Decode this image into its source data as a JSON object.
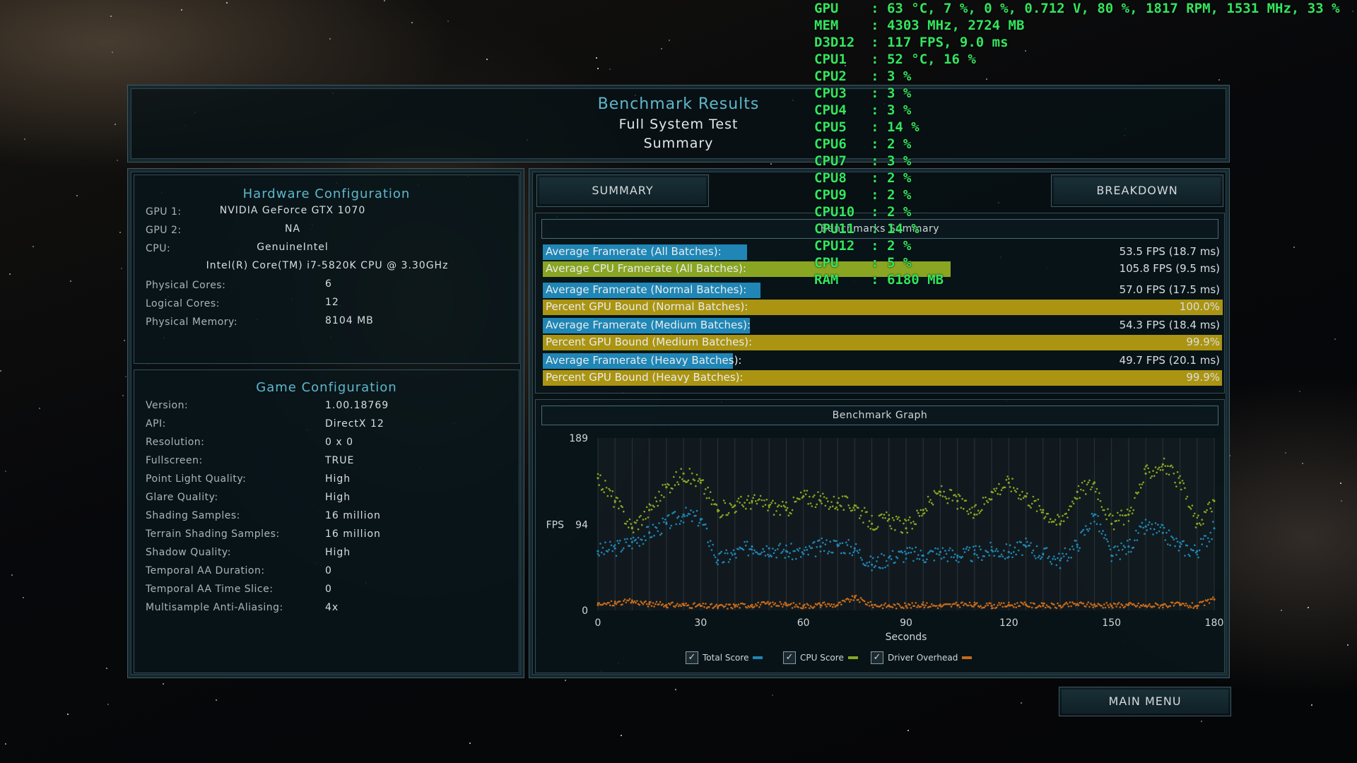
{
  "header": {
    "title": "Benchmark Results",
    "subtitle": "Full System Test",
    "subtitle2": "Summary"
  },
  "hardware": {
    "title": "Hardware Configuration",
    "rows": [
      {
        "label": "GPU 1:",
        "value": "NVIDIA GeForce GTX 1070"
      },
      {
        "label": "GPU 2:",
        "value": "NA"
      },
      {
        "label": "CPU:",
        "value": "GenuineIntel"
      },
      {
        "label": "",
        "value": "Intel(R) Core(TM) i7-5820K CPU @ 3.30GHz"
      },
      {
        "label": "Physical Cores:",
        "value": "6"
      },
      {
        "label": "Logical Cores:",
        "value": "12"
      },
      {
        "label": "Physical Memory:",
        "value": "8104 MB"
      }
    ]
  },
  "game": {
    "title": "Game Configuration",
    "rows": [
      {
        "label": "Version:",
        "value": "1.00.18769"
      },
      {
        "label": "API:",
        "value": "DirectX 12"
      },
      {
        "label": "Resolution:",
        "value": "0 x 0"
      },
      {
        "label": "Fullscreen:",
        "value": "TRUE"
      },
      {
        "label": "Point Light Quality:",
        "value": "High"
      },
      {
        "label": "Glare Quality:",
        "value": "High"
      },
      {
        "label": "Shading Samples:",
        "value": "16 million"
      },
      {
        "label": "Terrain Shading Samples:",
        "value": "16 million"
      },
      {
        "label": "Shadow Quality:",
        "value": "High"
      },
      {
        "label": "Temporal AA Duration:",
        "value": "0"
      },
      {
        "label": "Temporal AA Time Slice:",
        "value": "0"
      },
      {
        "label": "Multisample Anti-Aliasing:",
        "value": "4x"
      }
    ]
  },
  "tabs": {
    "summary": "SUMMARY",
    "breakdown": "BREAKDOWN"
  },
  "summary": {
    "title": "Benchmarks Summary",
    "rows": [
      {
        "label": "Average Framerate (All Batches):",
        "value": "53.5 FPS (18.7 ms)",
        "fill": 0.3,
        "color": "#1f86b5"
      },
      {
        "label": "Average CPU Framerate (All Batches):",
        "value": "105.8 FPS (9.5 ms)",
        "fill": 0.6,
        "color": "#8aa521"
      },
      {
        "label": "Average Framerate (Normal Batches):",
        "value": "57.0 FPS (17.5 ms)",
        "fill": 0.32,
        "color": "#1f86b5"
      },
      {
        "label": "Percent GPU Bound (Normal Batches):",
        "value": "100.0%",
        "fill": 1.0,
        "color": "#ab9411"
      },
      {
        "label": "Average Framerate (Medium Batches):",
        "value": "54.3 FPS (18.4 ms)",
        "fill": 0.305,
        "color": "#1f86b5"
      },
      {
        "label": "Percent GPU Bound (Medium Batches):",
        "value": "99.9%",
        "fill": 0.999,
        "color": "#ab9411"
      },
      {
        "label": "Average Framerate (Heavy Batches):",
        "value": "49.7 FPS (20.1 ms)",
        "fill": 0.28,
        "color": "#1f86b5"
      },
      {
        "label": "Percent GPU Bound (Heavy Batches):",
        "value": "99.9%",
        "fill": 0.999,
        "color": "#ab9411"
      }
    ]
  },
  "graph": {
    "title": "Benchmark Graph",
    "ylabel": "FPS",
    "xlabel": "Seconds",
    "legend": [
      {
        "label": "Total Score",
        "color": "#1f86b5"
      },
      {
        "label": "CPU Score",
        "color": "#8aa521"
      },
      {
        "label": "Driver Overhead",
        "color": "#c56a1a"
      }
    ]
  },
  "chart_data": {
    "type": "scatter",
    "title": "Benchmark Graph",
    "xlabel": "Seconds",
    "ylabel": "FPS",
    "xlim": [
      0,
      180
    ],
    "ylim": [
      0,
      189
    ],
    "xticks": [
      0,
      30,
      60,
      90,
      120,
      150,
      180
    ],
    "yticks": [
      0,
      94,
      189
    ],
    "x": [
      0,
      5,
      10,
      15,
      20,
      25,
      30,
      35,
      40,
      45,
      50,
      55,
      60,
      65,
      70,
      75,
      80,
      85,
      90,
      95,
      100,
      105,
      110,
      115,
      120,
      125,
      130,
      135,
      140,
      145,
      150,
      155,
      160,
      165,
      170,
      175,
      180
    ],
    "series": [
      {
        "name": "Total Score",
        "color": "#1f86b5",
        "values": [
          65,
          68,
          75,
          85,
          95,
          105,
          100,
          55,
          62,
          70,
          68,
          65,
          62,
          70,
          72,
          68,
          50,
          58,
          62,
          60,
          64,
          60,
          62,
          66,
          64,
          70,
          62,
          55,
          72,
          105,
          60,
          70,
          92,
          85,
          70,
          65,
          90
        ]
      },
      {
        "name": "CPU Score",
        "color": "#8aa521",
        "values": [
          145,
          120,
          90,
          110,
          135,
          150,
          140,
          110,
          115,
          120,
          115,
          110,
          125,
          120,
          118,
          115,
          95,
          100,
          90,
          110,
          130,
          120,
          105,
          130,
          140,
          125,
          110,
          95,
          130,
          140,
          95,
          105,
          150,
          160,
          140,
          95,
          120
        ]
      },
      {
        "name": "Driver Overhead",
        "color": "#c56a1a",
        "values": [
          6,
          8,
          10,
          7,
          6,
          6,
          5,
          4,
          5,
          6,
          7,
          6,
          5,
          6,
          6,
          14,
          6,
          5,
          5,
          6,
          5,
          6,
          6,
          5,
          6,
          6,
          5,
          5,
          7,
          6,
          5,
          6,
          5,
          6,
          6,
          5,
          12
        ]
      }
    ]
  },
  "osd": {
    "lines": [
      "GPU    : 63 °C, 7 %, 0 %, 0.712 V, 80 %, 1817 RPM, 1531 MHz, 33 %",
      "MEM    : 4303 MHz, 2724 MB",
      "D3D12  : 117 FPS, 9.0 ms",
      "CPU1   : 52 °C, 16 %",
      "CPU2   : 3 %",
      "CPU3   : 3 %",
      "CPU4   : 3 %",
      "CPU5   : 14 %",
      "CPU6   : 2 %",
      "CPU7   : 3 %",
      "CPU8   : 2 %",
      "CPU9   : 2 %",
      "CPU10  : 2 %",
      "CPU11  : 14 %",
      "CPU12  : 2 %",
      "CPU    : 5 %",
      "RAM    : 6180 MB"
    ]
  },
  "main_menu_label": "MAIN MENU"
}
